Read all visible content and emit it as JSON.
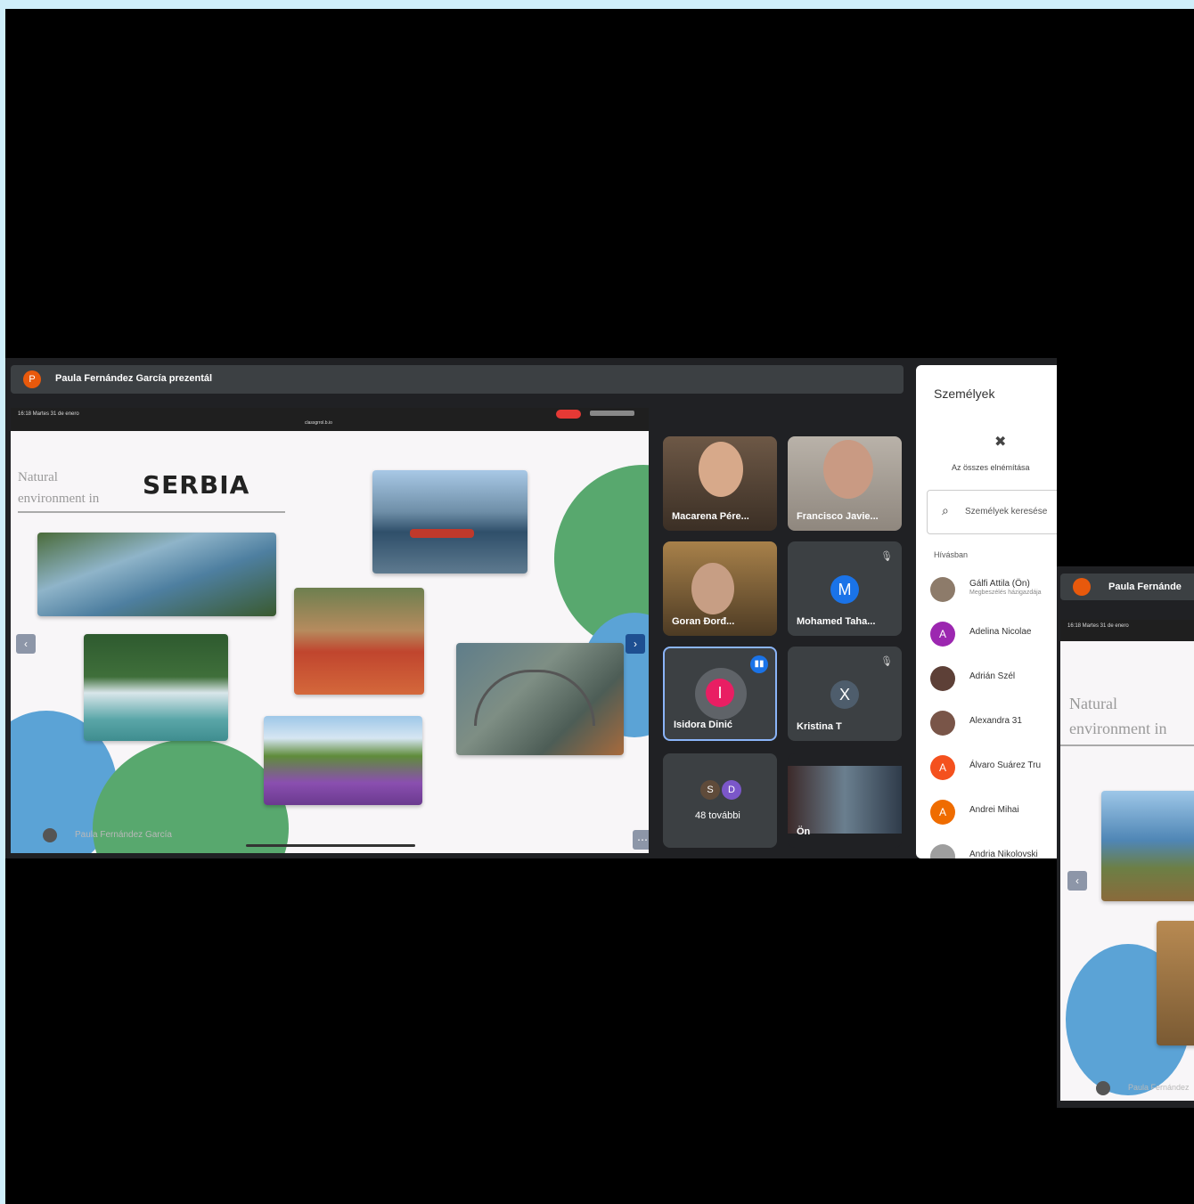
{
  "presenter": {
    "initial": "P",
    "label": "Paula Fernández García prezentál"
  },
  "slide": {
    "status_left": "16:18  Martes 31 de enero",
    "status_center": "classgrrol.b.io",
    "title_small": [
      "Natural",
      "environment in"
    ],
    "title_big": "SERBIA",
    "footer_author": "Paula Fernández García",
    "prev_icon": "‹",
    "next_icon": "›",
    "more_icon": "⋯"
  },
  "tiles": [
    {
      "name": "Macarena Pére..."
    },
    {
      "name": "Francisco Javie..."
    },
    {
      "name": "Goran Đorđ..."
    },
    {
      "name": "Mohamed Taha...",
      "initial": "M",
      "color": "#1a73e8"
    },
    {
      "name": "Isidora Dinić",
      "initial": "I",
      "color": "#e91e63"
    },
    {
      "name": "Kristina T",
      "initial": "X",
      "color": "#4e5d6c"
    },
    {
      "name": "48 további",
      "initials": [
        "S",
        "D"
      ]
    },
    {
      "name": "Ön"
    }
  ],
  "people": {
    "title": "Személyek",
    "mute_all": "Az összes elnémítása",
    "search_placeholder": "Személyek keresése",
    "section": "Hívásban",
    "list": [
      {
        "name": "Gálfi Attila (Ön)",
        "sub": "Megbeszélés házigazdája",
        "initial": "",
        "color": "#8d7b6a"
      },
      {
        "name": "Adelina Nicolae",
        "initial": "A",
        "color": "#9c27b0"
      },
      {
        "name": "Adrián Szél",
        "initial": "",
        "color": "#5d4037"
      },
      {
        "name": "Alexandra 31",
        "initial": "",
        "color": "#795548"
      },
      {
        "name": "Álvaro Suárez Tru",
        "initial": "A",
        "color": "#f4511e"
      },
      {
        "name": "Andrei Mihai",
        "initial": "A",
        "color": "#ef6c00"
      },
      {
        "name": "Andria Nikolovski",
        "initial": "",
        "color": "#9e9e9e"
      }
    ]
  },
  "secondary": {
    "presenter_label": "Paula Fernánde",
    "status_left": "16:18  Martes 31 de enero",
    "title_small": [
      "Natural",
      "environment in"
    ],
    "footer_author": "Paula Fernández"
  }
}
